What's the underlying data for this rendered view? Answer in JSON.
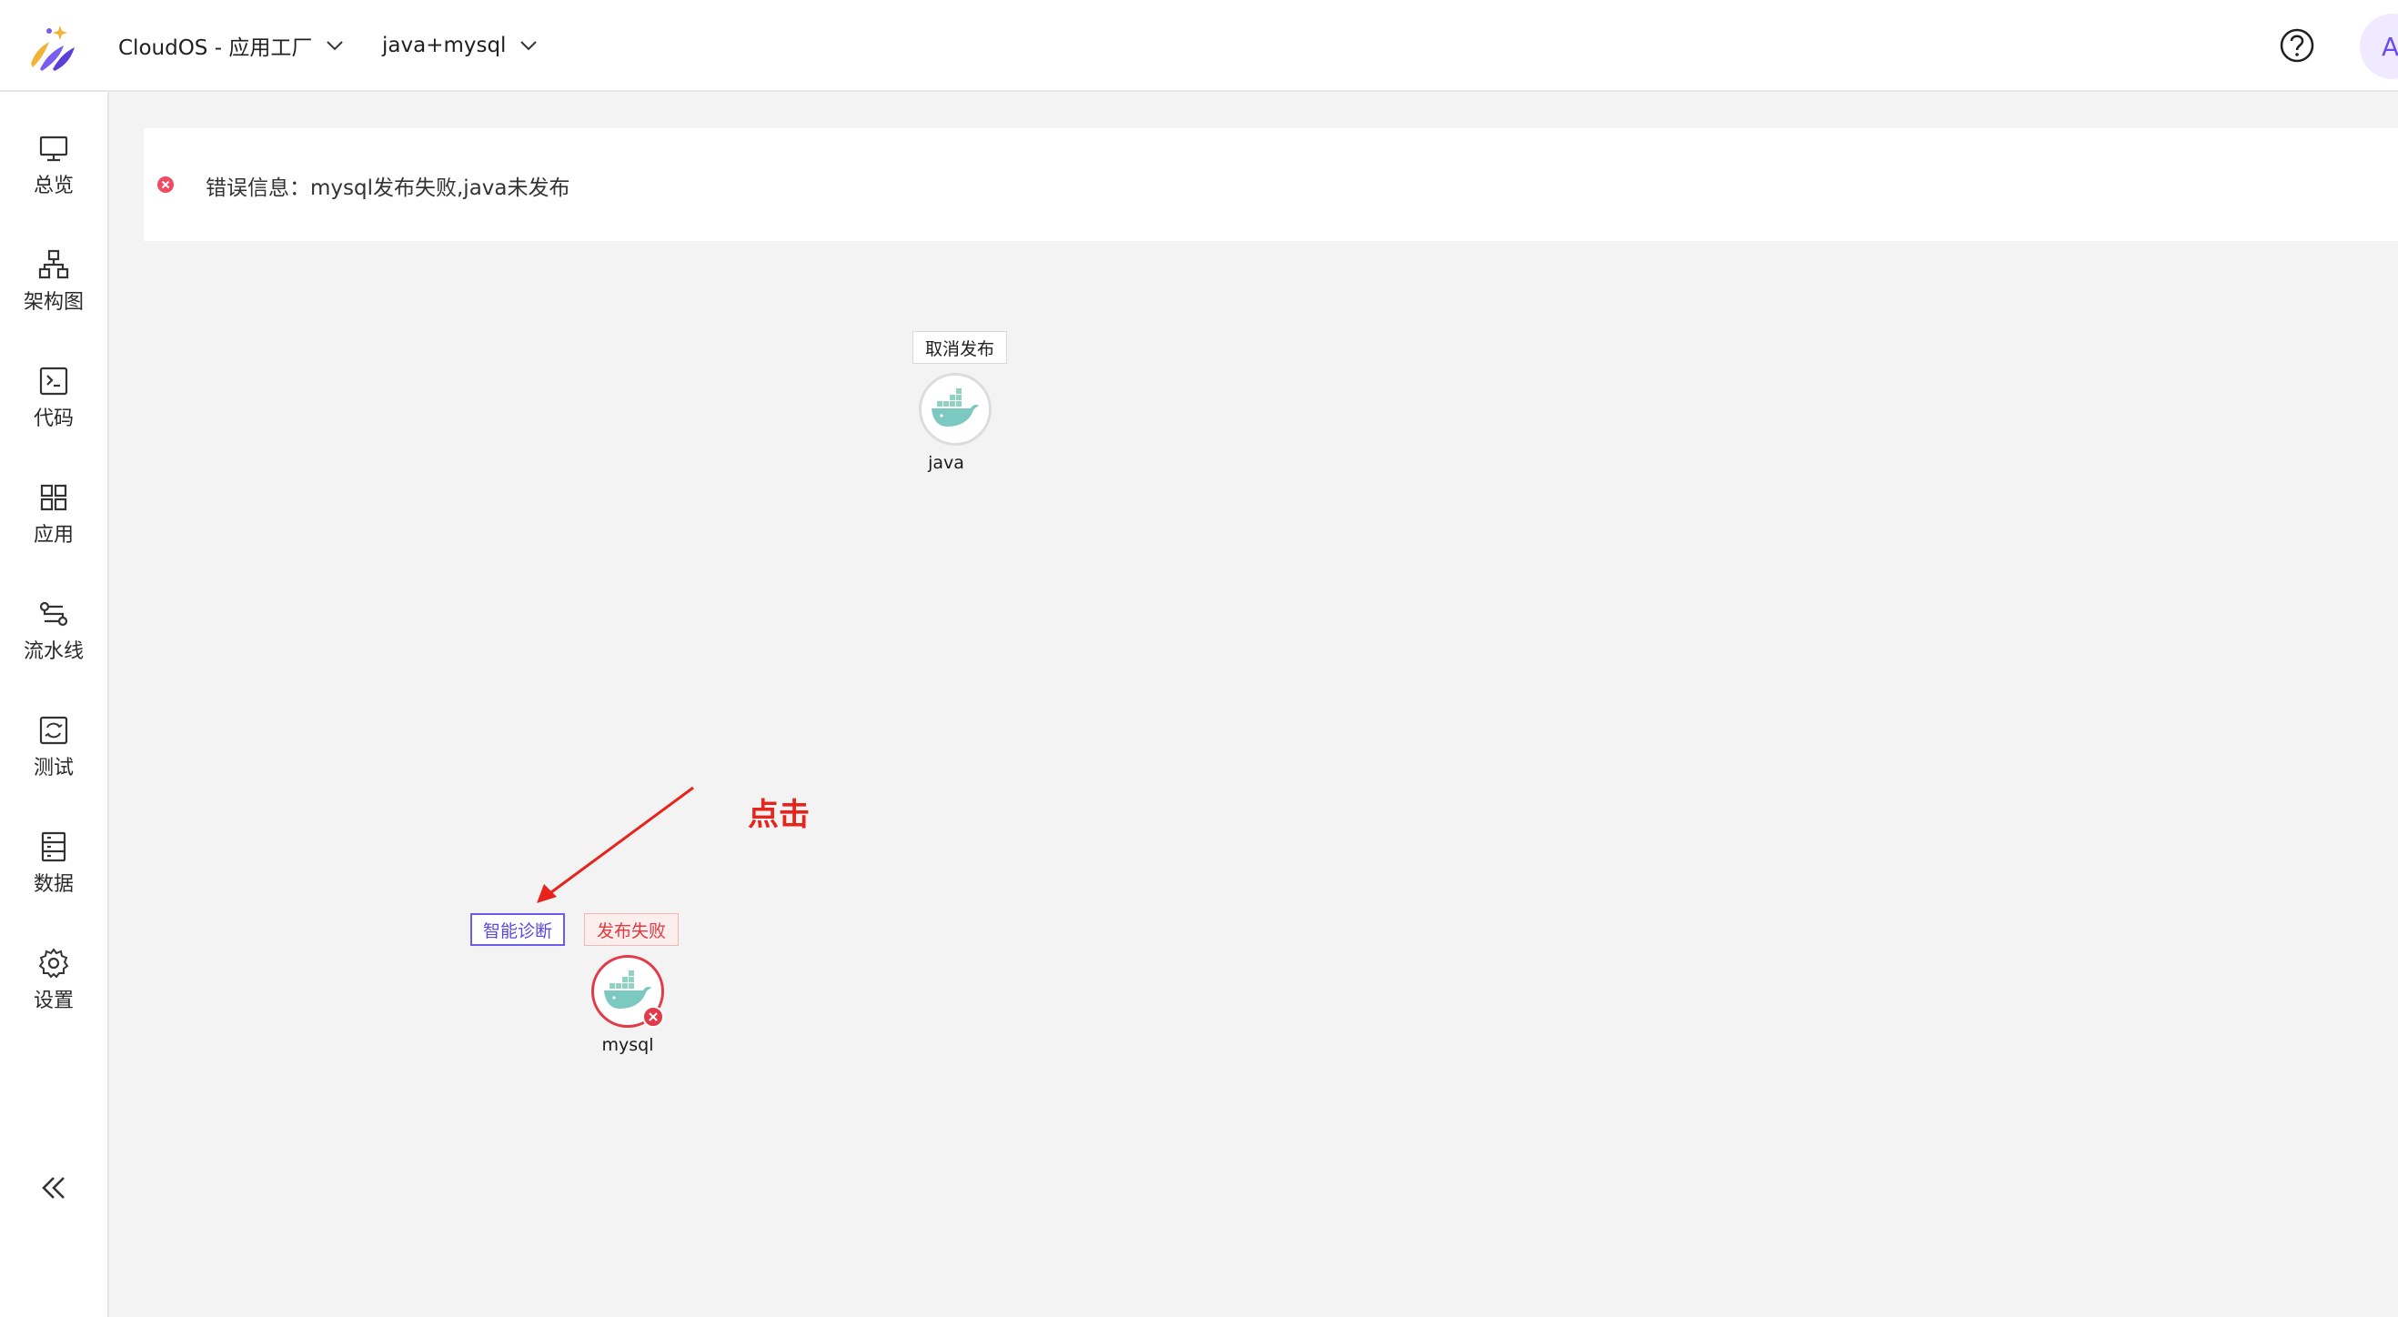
{
  "header": {
    "app_selector": "CloudOS - 应用工厂",
    "project_selector": "java+mysql",
    "avatar_initial": "A"
  },
  "sidebar": {
    "items": [
      {
        "label": "总览",
        "icon": "monitor-icon"
      },
      {
        "label": "架构图",
        "icon": "architecture-icon"
      },
      {
        "label": "代码",
        "icon": "terminal-icon"
      },
      {
        "label": "应用",
        "icon": "apps-grid-icon"
      },
      {
        "label": "流水线",
        "icon": "pipeline-icon"
      },
      {
        "label": "测试",
        "icon": "test-icon"
      },
      {
        "label": "数据",
        "icon": "database-icon"
      },
      {
        "label": "设置",
        "icon": "gear-icon"
      }
    ]
  },
  "error_banner": {
    "text": "错误信息：mysql发布失败,java未发布"
  },
  "canvas": {
    "java_node": {
      "name": "java",
      "action": "取消发布"
    },
    "mysql_node": {
      "name": "mysql",
      "diagnose_button": "智能诊断",
      "status": "发布失败"
    },
    "annotation": "点击"
  },
  "colors": {
    "accent": "#6b5cf0",
    "error": "#e23a48",
    "annotation": "#e8231b"
  }
}
